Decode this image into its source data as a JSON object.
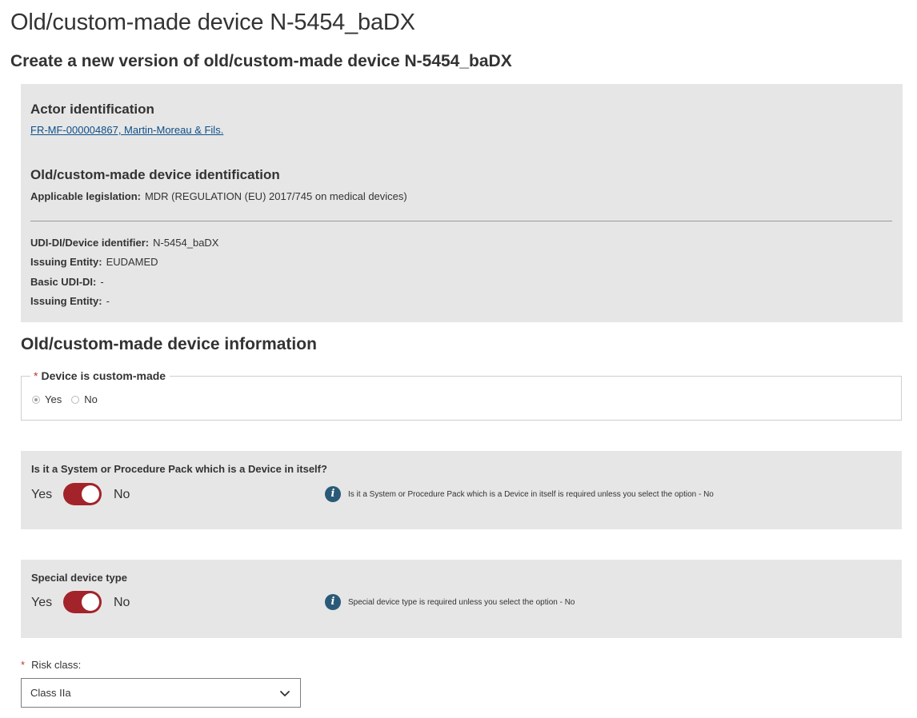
{
  "header": {
    "title": "Old/custom-made device N-5454_baDX",
    "subtitle": "Create a new version of old/custom-made device N-5454_baDX"
  },
  "identification": {
    "actor_heading": "Actor identification",
    "actor_link": "FR-MF-000004867, Martin-Moreau & Fils.",
    "device_heading": "Old/custom-made device identification",
    "legislation_label": "Applicable legislation:",
    "legislation_value": "MDR (REGULATION (EU) 2017/745 on medical devices)",
    "udi_label": "UDI-DI/Device identifier:",
    "udi_value": "N-5454_baDX",
    "issuing_label": "Issuing Entity:",
    "issuing_value": "EUDAMED",
    "basic_udi_label": "Basic UDI-DI:",
    "basic_udi_value": "-",
    "issuing2_label": "Issuing Entity:",
    "issuing2_value": "-"
  },
  "device_info": {
    "title": "Old/custom-made device information",
    "custom_made": {
      "required_mark": "*",
      "legend": "Device is custom-made",
      "options": [
        "Yes",
        "No"
      ],
      "selected": "Yes"
    },
    "system_pack": {
      "question": "Is it a System or Procedure Pack which is a Device in itself?",
      "yes_label": "Yes",
      "no_label": "No",
      "info": "Is it a System or Procedure Pack which is a Device in itself is required unless you select the option - No"
    },
    "special_type": {
      "question": "Special device type",
      "yes_label": "Yes",
      "no_label": "No",
      "info": "Special device type is required unless you select the option - No"
    },
    "risk_class": {
      "required_mark": "*",
      "label": "Risk class:",
      "value": "Class IIa"
    }
  },
  "colors": {
    "toggle_on": "#a3232a",
    "info_icon": "#2a5a78",
    "panel_bg": "#e6e6e6",
    "link": "#0e4f8a"
  },
  "icons": {
    "info": "info-icon",
    "dropdown": "chevron-down-icon"
  }
}
